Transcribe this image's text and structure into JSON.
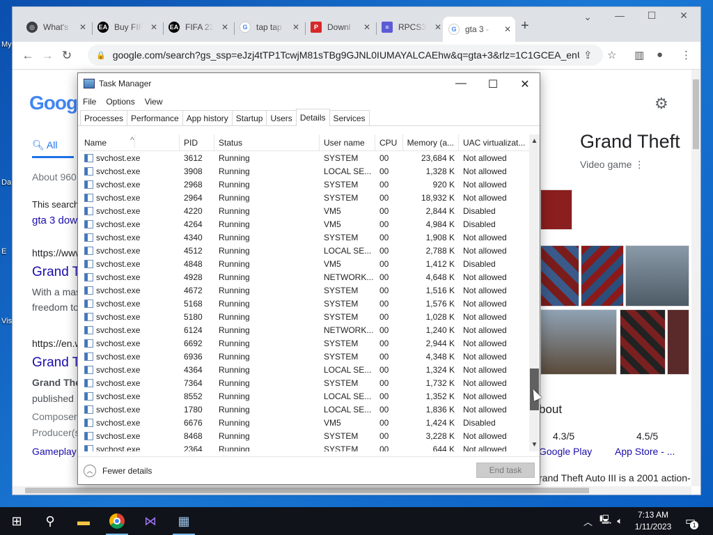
{
  "desktop": {
    "labels": [
      "My",
      "Da",
      "E",
      "Vis"
    ]
  },
  "browser": {
    "tabs": [
      {
        "label": "What's",
        "favicon": "chrome-icon",
        "color": "#3c4043"
      },
      {
        "label": "Buy FIF",
        "favicon": "ea-icon",
        "color": "#000000"
      },
      {
        "label": "FIFA 23",
        "favicon": "ea-icon",
        "color": "#000000"
      },
      {
        "label": "tap tap",
        "favicon": "google-icon",
        "color": "#4285f4"
      },
      {
        "label": "Downl",
        "favicon": "p-icon",
        "color": "#d62828"
      },
      {
        "label": "RPCS3",
        "favicon": "rpcs3-icon",
        "color": "#5b5bd6"
      },
      {
        "label": "gta 3 -",
        "favicon": "google-icon",
        "color": "#4285f4",
        "active": true
      }
    ],
    "new_tab": "+",
    "url": "google.com/search?gs_ssp=eJzj4tTP1TcwjM81sTBg9GJNL0IUMAYALCAEhw&q=gta+3&rlz=1C1GCEA_enUS..."
  },
  "google": {
    "logo": "Goog",
    "all_tab": "All",
    "about": "About 960",
    "this_search": "This search",
    "gta3_link": "gta 3 dow",
    "url1": "https://www",
    "grand1": "Grand T",
    "with_a_mas": "With a mas",
    "freedom": "freedom to",
    "url2": "https://en.w",
    "grand2": "Grand T",
    "grand_the": "Grand The",
    "published": "published",
    "composer": "Composer",
    "producer": "Producer(s",
    "gameplay": "Gameplay",
    "kp_title": "Grand Theft",
    "kp_sub": "Video game",
    "about_h": "bout",
    "rating1": "4.3/5",
    "rating1_src": "Google Play",
    "rating2": "4.5/5",
    "rating2_src": "App Store - ...",
    "desc": "rand Theft Auto III is a 2001 action-"
  },
  "taskmgr": {
    "title": "Task Manager",
    "menu": [
      "File",
      "Options",
      "View"
    ],
    "tabs": [
      "Processes",
      "Performance",
      "App history",
      "Startup",
      "Users",
      "Details",
      "Services"
    ],
    "active_tab": "Details",
    "columns": [
      "Name",
      "PID",
      "Status",
      "User name",
      "CPU",
      "Memory (a...",
      "UAC virtualizat..."
    ],
    "rows": [
      [
        "svchost.exe",
        "3612",
        "Running",
        "SYSTEM",
        "00",
        "23,684 K",
        "Not allowed"
      ],
      [
        "svchost.exe",
        "3908",
        "Running",
        "LOCAL SE...",
        "00",
        "1,328 K",
        "Not allowed"
      ],
      [
        "svchost.exe",
        "2968",
        "Running",
        "SYSTEM",
        "00",
        "920 K",
        "Not allowed"
      ],
      [
        "svchost.exe",
        "2964",
        "Running",
        "SYSTEM",
        "00",
        "18,932 K",
        "Not allowed"
      ],
      [
        "svchost.exe",
        "4220",
        "Running",
        "VM5",
        "00",
        "2,844 K",
        "Disabled"
      ],
      [
        "svchost.exe",
        "4264",
        "Running",
        "VM5",
        "00",
        "4,984 K",
        "Disabled"
      ],
      [
        "svchost.exe",
        "4340",
        "Running",
        "SYSTEM",
        "00",
        "1,908 K",
        "Not allowed"
      ],
      [
        "svchost.exe",
        "4512",
        "Running",
        "LOCAL SE...",
        "00",
        "2,788 K",
        "Not allowed"
      ],
      [
        "svchost.exe",
        "4848",
        "Running",
        "VM5",
        "00",
        "1,412 K",
        "Disabled"
      ],
      [
        "svchost.exe",
        "4928",
        "Running",
        "NETWORK...",
        "00",
        "4,648 K",
        "Not allowed"
      ],
      [
        "svchost.exe",
        "4672",
        "Running",
        "SYSTEM",
        "00",
        "1,516 K",
        "Not allowed"
      ],
      [
        "svchost.exe",
        "5168",
        "Running",
        "SYSTEM",
        "00",
        "1,576 K",
        "Not allowed"
      ],
      [
        "svchost.exe",
        "5180",
        "Running",
        "SYSTEM",
        "00",
        "1,028 K",
        "Not allowed"
      ],
      [
        "svchost.exe",
        "6124",
        "Running",
        "NETWORK...",
        "00",
        "1,240 K",
        "Not allowed"
      ],
      [
        "svchost.exe",
        "6692",
        "Running",
        "SYSTEM",
        "00",
        "2,944 K",
        "Not allowed"
      ],
      [
        "svchost.exe",
        "6936",
        "Running",
        "SYSTEM",
        "00",
        "4,348 K",
        "Not allowed"
      ],
      [
        "svchost.exe",
        "4364",
        "Running",
        "LOCAL SE...",
        "00",
        "1,324 K",
        "Not allowed"
      ],
      [
        "svchost.exe",
        "7364",
        "Running",
        "SYSTEM",
        "00",
        "1,732 K",
        "Not allowed"
      ],
      [
        "svchost.exe",
        "8552",
        "Running",
        "LOCAL SE...",
        "00",
        "1,352 K",
        "Not allowed"
      ],
      [
        "svchost.exe",
        "1780",
        "Running",
        "LOCAL SE...",
        "00",
        "1,836 K",
        "Not allowed"
      ],
      [
        "svchost.exe",
        "6676",
        "Running",
        "VM5",
        "00",
        "1,424 K",
        "Disabled"
      ],
      [
        "svchost.exe",
        "8468",
        "Running",
        "SYSTEM",
        "00",
        "3,228 K",
        "Not allowed"
      ],
      [
        "svchost.exe",
        "2364",
        "Running",
        "SYSTEM",
        "00",
        "644 K",
        "Not allowed"
      ]
    ],
    "fewer_details": "Fewer details",
    "end_task": "End task"
  },
  "taskbar": {
    "time": "7:13 AM",
    "date": "1/11/2023",
    "notif_count": "1"
  }
}
